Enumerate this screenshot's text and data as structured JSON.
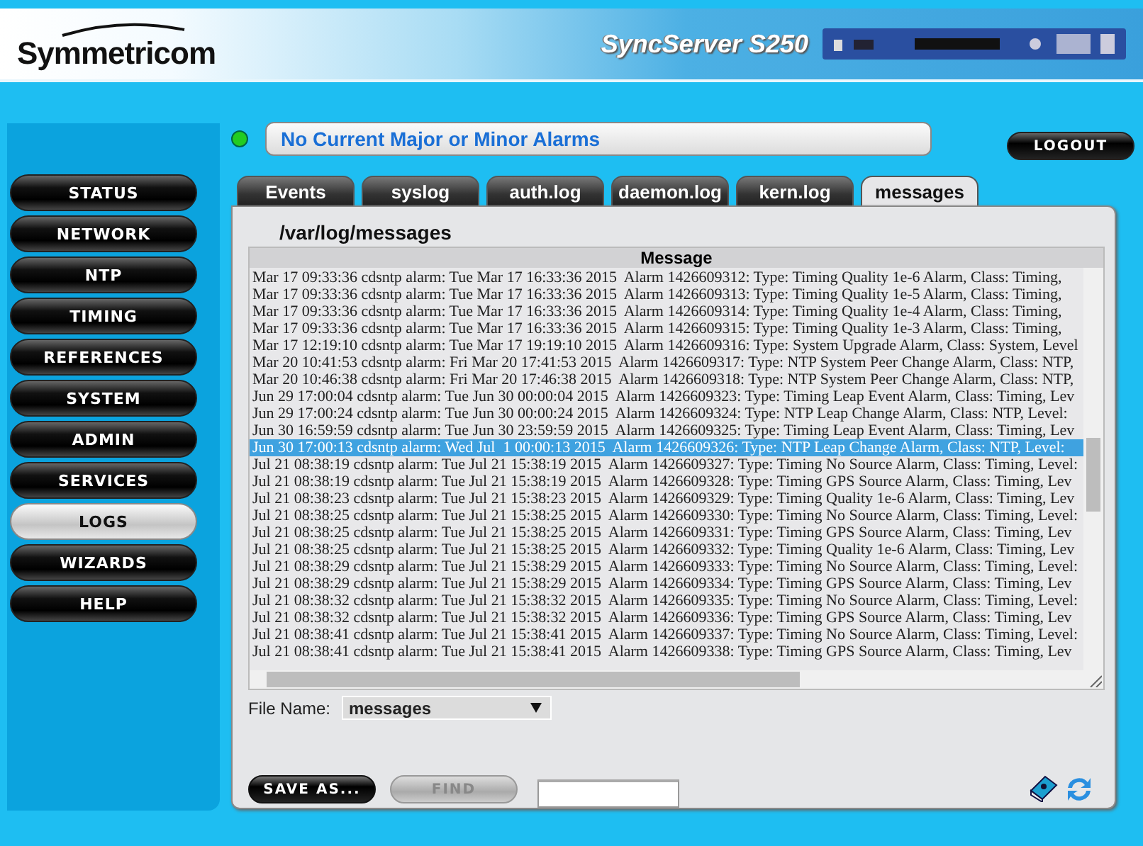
{
  "header": {
    "logo": "Symmetricom",
    "product": "SyncServer S250"
  },
  "nav": [
    {
      "label": "STATUS",
      "selected": false
    },
    {
      "label": "NETWORK",
      "selected": false
    },
    {
      "label": "NTP",
      "selected": false
    },
    {
      "label": "TIMING",
      "selected": false
    },
    {
      "label": "REFERENCES",
      "selected": false
    },
    {
      "label": "SYSTEM",
      "selected": false
    },
    {
      "label": "ADMIN",
      "selected": false
    },
    {
      "label": "SERVICES",
      "selected": false
    },
    {
      "label": "LOGS",
      "selected": true
    },
    {
      "label": "WIZARDS",
      "selected": false
    },
    {
      "label": "HELP",
      "selected": false
    }
  ],
  "alarm": {
    "text": "No Current Major or Minor Alarms",
    "ok": true
  },
  "logout": "LOGOUT",
  "tabs": [
    {
      "label": "Events",
      "selected": false
    },
    {
      "label": "syslog",
      "selected": false
    },
    {
      "label": "auth.log",
      "selected": false
    },
    {
      "label": "daemon.log",
      "selected": false
    },
    {
      "label": "kern.log",
      "selected": false
    },
    {
      "label": "messages",
      "selected": true
    }
  ],
  "panel": {
    "title": "/var/log/messages",
    "table": {
      "columns": [
        "Message"
      ],
      "rows": [
        {
          "text": "Mar 17 09:33:36 cdsntp alarm: Tue Mar 17 16:33:36 2015  Alarm 1426609312: Type: Timing Quality 1e-6 Alarm, Class: Timing,",
          "selected": false
        },
        {
          "text": "Mar 17 09:33:36 cdsntp alarm: Tue Mar 17 16:33:36 2015  Alarm 1426609313: Type: Timing Quality 1e-5 Alarm, Class: Timing,",
          "selected": false
        },
        {
          "text": "Mar 17 09:33:36 cdsntp alarm: Tue Mar 17 16:33:36 2015  Alarm 1426609314: Type: Timing Quality 1e-4 Alarm, Class: Timing,",
          "selected": false
        },
        {
          "text": "Mar 17 09:33:36 cdsntp alarm: Tue Mar 17 16:33:36 2015  Alarm 1426609315: Type: Timing Quality 1e-3 Alarm, Class: Timing,",
          "selected": false
        },
        {
          "text": "Mar 17 12:19:10 cdsntp alarm: Tue Mar 17 19:19:10 2015  Alarm 1426609316: Type: System Upgrade Alarm, Class: System, Level",
          "selected": false
        },
        {
          "text": "Mar 20 10:41:53 cdsntp alarm: Fri Mar 20 17:41:53 2015  Alarm 1426609317: Type: NTP System Peer Change Alarm, Class: NTP,",
          "selected": false
        },
        {
          "text": "Mar 20 10:46:38 cdsntp alarm: Fri Mar 20 17:46:38 2015  Alarm 1426609318: Type: NTP System Peer Change Alarm, Class: NTP,",
          "selected": false
        },
        {
          "text": "Jun 29 17:00:04 cdsntp alarm: Tue Jun 30 00:00:04 2015  Alarm 1426609323: Type: Timing Leap Event Alarm, Class: Timing, Lev",
          "selected": false
        },
        {
          "text": "Jun 29 17:00:24 cdsntp alarm: Tue Jun 30 00:00:24 2015  Alarm 1426609324: Type: NTP Leap Change Alarm, Class: NTP, Level:",
          "selected": false
        },
        {
          "text": "Jun 30 16:59:59 cdsntp alarm: Tue Jun 30 23:59:59 2015  Alarm 1426609325: Type: Timing Leap Event Alarm, Class: Timing, Lev",
          "selected": false
        },
        {
          "text": "Jun 30 17:00:13 cdsntp alarm: Wed Jul  1 00:00:13 2015  Alarm 1426609326: Type: NTP Leap Change Alarm, Class: NTP, Level:",
          "selected": true
        },
        {
          "text": "Jul 21 08:38:19 cdsntp alarm: Tue Jul 21 15:38:19 2015  Alarm 1426609327: Type: Timing No Source Alarm, Class: Timing, Level:",
          "selected": false
        },
        {
          "text": "Jul 21 08:38:19 cdsntp alarm: Tue Jul 21 15:38:19 2015  Alarm 1426609328: Type: Timing GPS Source Alarm, Class: Timing, Lev",
          "selected": false
        },
        {
          "text": "Jul 21 08:38:23 cdsntp alarm: Tue Jul 21 15:38:23 2015  Alarm 1426609329: Type: Timing Quality 1e-6 Alarm, Class: Timing, Lev",
          "selected": false
        },
        {
          "text": "Jul 21 08:38:25 cdsntp alarm: Tue Jul 21 15:38:25 2015  Alarm 1426609330: Type: Timing No Source Alarm, Class: Timing, Level:",
          "selected": false
        },
        {
          "text": "Jul 21 08:38:25 cdsntp alarm: Tue Jul 21 15:38:25 2015  Alarm 1426609331: Type: Timing GPS Source Alarm, Class: Timing, Lev",
          "selected": false
        },
        {
          "text": "Jul 21 08:38:25 cdsntp alarm: Tue Jul 21 15:38:25 2015  Alarm 1426609332: Type: Timing Quality 1e-6 Alarm, Class: Timing, Lev",
          "selected": false
        },
        {
          "text": "Jul 21 08:38:29 cdsntp alarm: Tue Jul 21 15:38:29 2015  Alarm 1426609333: Type: Timing No Source Alarm, Class: Timing, Level:",
          "selected": false
        },
        {
          "text": "Jul 21 08:38:29 cdsntp alarm: Tue Jul 21 15:38:29 2015  Alarm 1426609334: Type: Timing GPS Source Alarm, Class: Timing, Lev",
          "selected": false
        },
        {
          "text": "Jul 21 08:38:32 cdsntp alarm: Tue Jul 21 15:38:32 2015  Alarm 1426609335: Type: Timing No Source Alarm, Class: Timing, Level:",
          "selected": false
        },
        {
          "text": "Jul 21 08:38:32 cdsntp alarm: Tue Jul 21 15:38:32 2015  Alarm 1426609336: Type: Timing GPS Source Alarm, Class: Timing, Lev",
          "selected": false
        },
        {
          "text": "Jul 21 08:38:41 cdsntp alarm: Tue Jul 21 15:38:41 2015  Alarm 1426609337: Type: Timing No Source Alarm, Class: Timing, Level:",
          "selected": false
        },
        {
          "text": "Jul 21 08:38:41 cdsntp alarm: Tue Jul 21 15:38:41 2015  Alarm 1426609338: Type: Timing GPS Source Alarm, Class: Timing, Lev",
          "selected": false
        }
      ]
    },
    "file_name": {
      "label": "File Name:",
      "value": "messages"
    },
    "save_button": {
      "label": "SAVE AS...",
      "disabled": false
    },
    "find_button": {
      "label": "FIND",
      "disabled": true
    }
  }
}
